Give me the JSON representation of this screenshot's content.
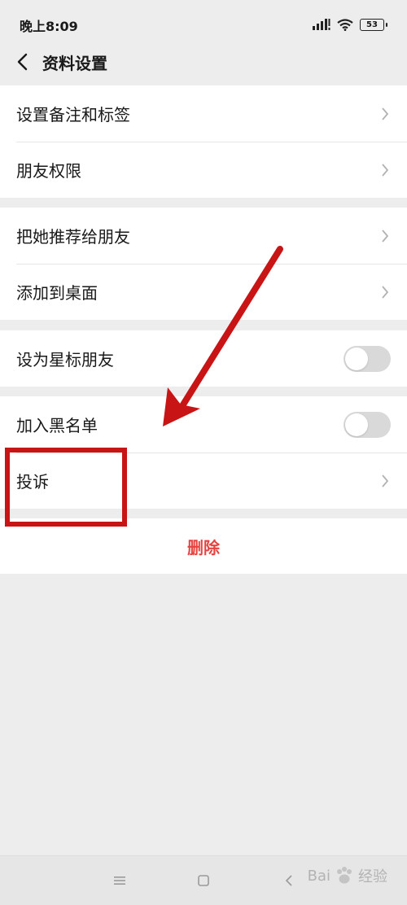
{
  "status": {
    "time": "晚上8:09",
    "battery": "53"
  },
  "header": {
    "title": "资料设置"
  },
  "groups": [
    {
      "rows": [
        {
          "label": "设置备注和标签"
        },
        {
          "label": "朋友权限"
        }
      ]
    },
    {
      "rows": [
        {
          "label": "把她推荐给朋友"
        },
        {
          "label": "添加到桌面"
        }
      ]
    },
    {
      "rows": [
        {
          "label": "设为星标朋友",
          "toggle": "off"
        }
      ]
    },
    {
      "rows": [
        {
          "label": "加入黑名单",
          "toggle": "off"
        },
        {
          "label": "投诉"
        }
      ]
    }
  ],
  "delete": {
    "label": "删除"
  },
  "watermark": {
    "text1": "Bai",
    "text2": "经验"
  },
  "colors": {
    "background": "#ededed",
    "delete_red": "#e64340",
    "annotation_red": "#c81414"
  }
}
